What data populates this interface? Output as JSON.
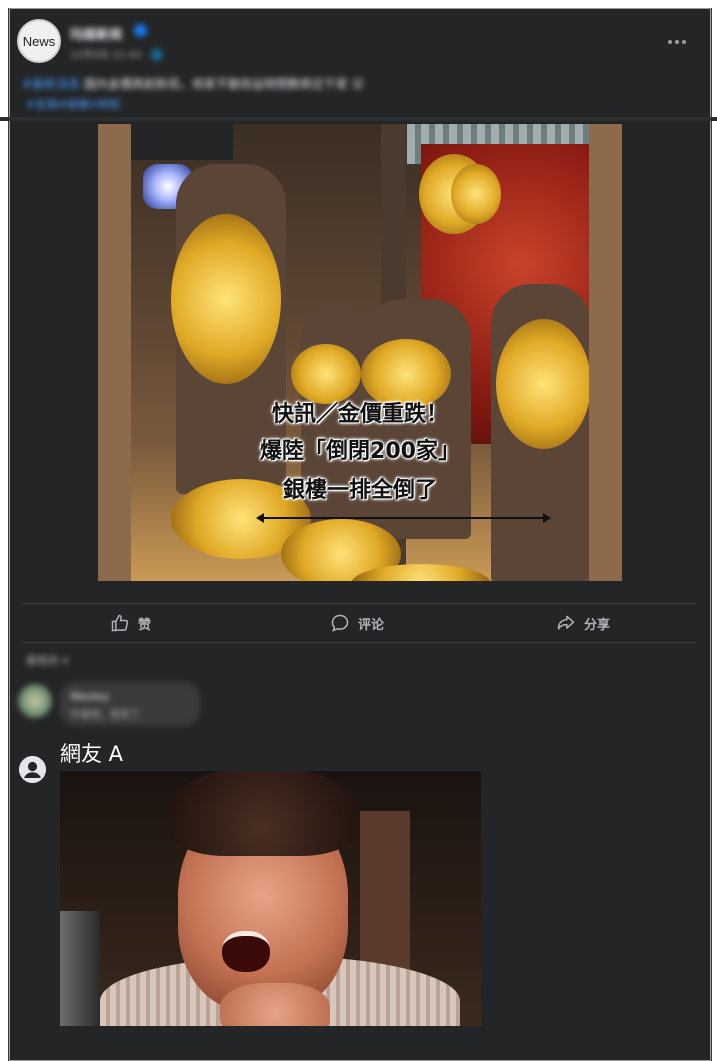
{
  "post": {
    "page_avatar_label": "News",
    "page_name": "玛媒新闻",
    "meta": "12月4日 21:43 · 🌐",
    "text_tag": "#最新消息",
    "text_body": " 國內金價再創新低，商家不敵收益倒閉數將近千家 😮",
    "link": "#金價#銀樓#倒閉"
  },
  "image_caption": {
    "line1": "快訊／金價重跌！",
    "line2": "爆陸「倒閉200家」",
    "line3": "銀樓一排全倒了"
  },
  "actions": {
    "like": "赞",
    "comment": "评论",
    "share": "分享"
  },
  "comments": {
    "sort_label": "最相关 ▾",
    "blurred_name": "Wesley",
    "blurred_text": "不會吧，笑死了",
    "reply_name": "網友 A"
  },
  "icons": {
    "like": "thumbs-up-icon",
    "comment": "comment-bubble-icon",
    "share": "share-arrow-icon",
    "more": "more-dots-icon",
    "user": "user-avatar-icon",
    "verified": "verified-badge-icon"
  },
  "colors": {
    "background": "#242526",
    "text_primary": "#e4e6eb",
    "text_secondary": "#b0b3b8",
    "link": "#4599ff",
    "verified": "#1877f2"
  }
}
